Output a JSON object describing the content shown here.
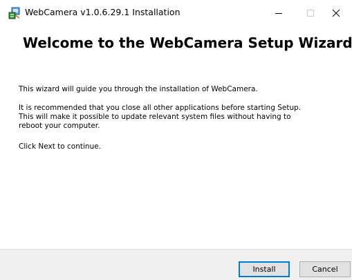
{
  "window": {
    "title": "WebCamera v1.0.6.29.1 Installation",
    "app_icon": "installer-app-icon",
    "controls": {
      "minimize_icon": "minimize-icon",
      "maximize_icon": "maximize-icon",
      "close_icon": "close-icon"
    }
  },
  "main": {
    "heading": "Welcome to the WebCamera Setup Wizard",
    "paragraphs": [
      "This wizard will guide you through the installation of WebCamera.",
      "It is recommended that you close all other applications before starting Setup. This will make it possible to update relevant system files without having to reboot your computer.",
      "Click Next to continue."
    ]
  },
  "footer": {
    "install_label": "Install",
    "cancel_label": "Cancel"
  },
  "colors": {
    "focus_border": "#0078d7",
    "footer_background": "#f0f0f0",
    "button_face": "#e1e1e1"
  }
}
